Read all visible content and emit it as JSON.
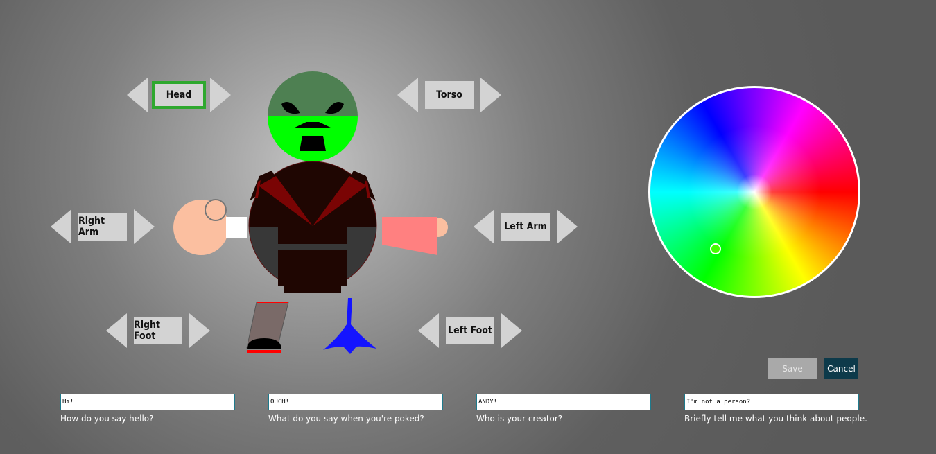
{
  "part_selectors": {
    "head": {
      "label": "Head",
      "selected": true
    },
    "torso": {
      "label": "Torso",
      "selected": false
    },
    "right_arm": {
      "label": "Right Arm",
      "selected": false
    },
    "left_arm": {
      "label": "Left Arm",
      "selected": false
    },
    "right_foot": {
      "label": "Right Foot",
      "selected": false
    },
    "left_foot": {
      "label": "Left Foot",
      "selected": false
    }
  },
  "character_colors": {
    "head_top": "#4e8052",
    "head_bottom": "#00ff00",
    "torso_main": "#1f0602",
    "torso_accent": "#7a0404",
    "torso_sides": "#383838",
    "skin": "#fbbfa0",
    "left_sleeve": "#ff8080",
    "right_cuff": "#ffffff",
    "right_leg": "#7a6a68",
    "right_shoe": "#000000",
    "shoe_trim": "#ff0000",
    "left_foot": "#1414ff"
  },
  "color_wheel": {
    "selected_color": "#44ff00",
    "border_color": "#ffffff"
  },
  "actions": {
    "save_label": "Save",
    "cancel_label": "Cancel"
  },
  "questions": [
    {
      "value": "Hi!",
      "label": "How do you say hello?"
    },
    {
      "value": "OUCH!",
      "label": "What do you say when you're poked?"
    },
    {
      "value": "ANDY!",
      "label": "Who is your creator?"
    },
    {
      "value": "I'm not a person?",
      "label": "Briefly tell me what you think about people."
    }
  ]
}
